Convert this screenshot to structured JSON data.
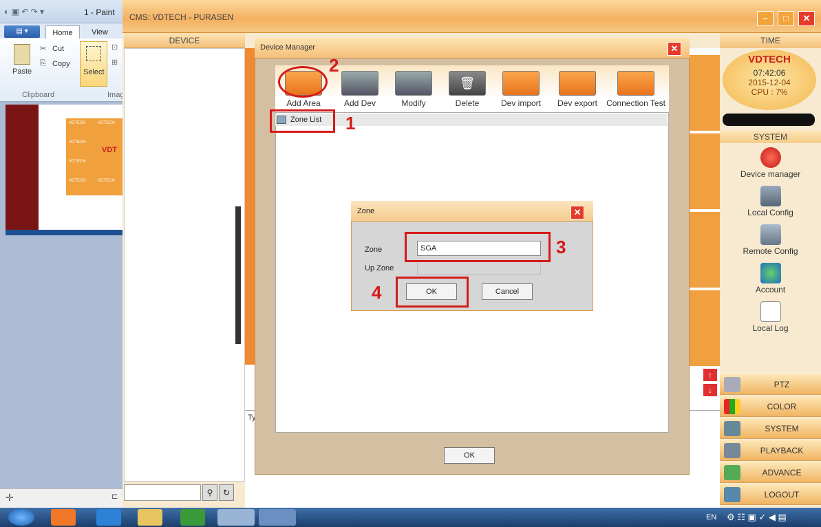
{
  "paint": {
    "title": "1 - Paint",
    "file_menu": "▤ ▾",
    "tabs": [
      "Home",
      "View"
    ],
    "paste_label": "Paste",
    "cut_label": "Cut",
    "copy_label": "Copy",
    "select_label": "Select",
    "clipboard_group": "Clipboard",
    "image_group": "Imag",
    "thumb_brand": "VDTECH",
    "thumb_brand_large": "VDT"
  },
  "cms": {
    "title": "CMS: VDTECH - PURASEN",
    "device_header": "DEVICE",
    "time_header": "TIME",
    "brand": "VDTECH",
    "clock_time": "07:42:06",
    "clock_date": "2015-12-04",
    "cpu": "CPU : 7%",
    "system_header": "SYSTEM",
    "side_items": [
      "Device manager",
      "Local Config",
      "Remote Config",
      "Account",
      "Local Log"
    ],
    "bottom_buttons": [
      "PTZ",
      "COLOR",
      "SYSTEM",
      "PLAYBACK",
      "ADVANCE",
      "LOGOUT"
    ],
    "column_fragment": "Ty"
  },
  "device_manager": {
    "title": "Device Manager",
    "toolbar": [
      "Add Area",
      "Add Dev",
      "Modify",
      "Delete",
      "Dev import",
      "Dev export",
      "Connection Test"
    ],
    "zone_list": "Zone List",
    "ok_label": "OK"
  },
  "zone_dialog": {
    "title": "Zone",
    "zone_label": "Zone",
    "zone_value": "SGA",
    "up_zone_label": "Up Zone",
    "ok_label": "OK",
    "cancel_label": "Cancel"
  },
  "annotations": [
    "1",
    "2",
    "3",
    "4"
  ],
  "taskbar": {
    "language": "EN"
  },
  "colors": {
    "accent": "#f4b060",
    "annotation_red": "#d51a1a",
    "close_red": "#e53a2a"
  }
}
